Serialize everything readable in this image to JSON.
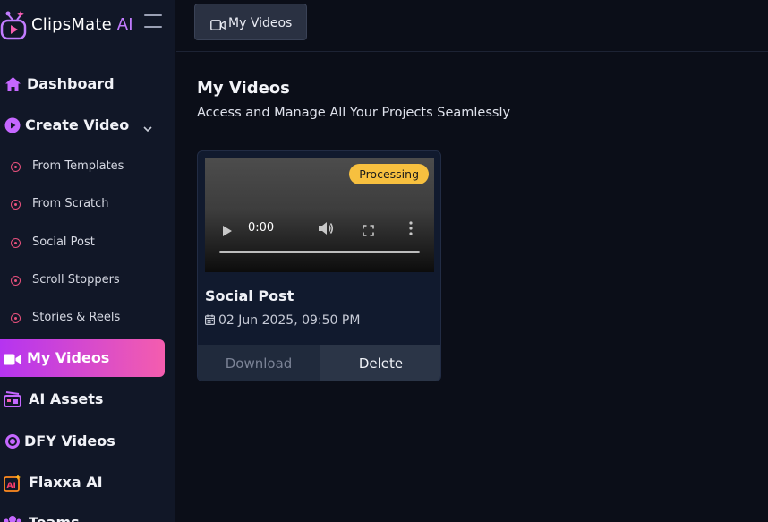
{
  "app": {
    "brand_name": "ClipsMate",
    "brand_suffix": "AI",
    "accent_colors": {
      "brand_purple": "#c27cff",
      "active_gradient_start": "#b534f0",
      "active_gradient_end": "#f45dae",
      "badge_yellow": "#f7c03f",
      "bullet_pink": "#e7507c"
    }
  },
  "sidebar": {
    "menu_icon": "hamburger-icon",
    "items": [
      {
        "label": "Dashboard",
        "icon": "home-icon"
      },
      {
        "label": "Create Video",
        "icon": "play-circle-icon",
        "chevron": "chevron-down-icon"
      },
      {
        "label": "My Videos",
        "icon": "video-camera-icon",
        "active": true
      },
      {
        "label": "AI Assets",
        "icon": "film-assets-icon"
      },
      {
        "label": "DFY Videos",
        "icon": "target-icon"
      },
      {
        "label": "Flaxxa AI",
        "icon": "ai-sparkle-icon"
      },
      {
        "label": "Teams",
        "icon": "team-icon"
      }
    ],
    "sub_items": [
      {
        "label": "From Templates"
      },
      {
        "label": "From Scratch"
      },
      {
        "label": "Social Post"
      },
      {
        "label": "Scroll Stoppers"
      },
      {
        "label": "Stories & Reels"
      }
    ]
  },
  "topbar": {
    "tab_label": "My Videos",
    "tab_icon": "video-camera-icon"
  },
  "main": {
    "title": "My Videos",
    "subtitle": "Access and Manage All Your Projects Seamlessly",
    "videos": [
      {
        "status": "Processing",
        "player_time": "0:00",
        "title": "Social Post",
        "date": "02 Jun 2025, 09:50 PM",
        "download_label": "Download",
        "delete_label": "Delete"
      }
    ]
  }
}
